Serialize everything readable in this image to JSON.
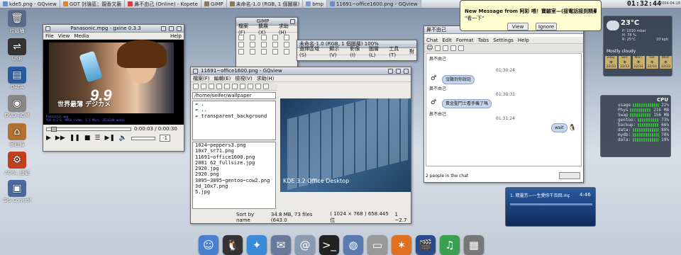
{
  "taskbar": {
    "items": [
      {
        "label": "kde5.png - GQview",
        "active": false,
        "color": "#6b8cc3"
      },
      {
        "label": "GOT 討論區：靚香文藝",
        "active": false,
        "color": "#d08a34"
      },
      {
        "label": "鼻不由己 (Online) - Kopete",
        "active": false,
        "color": "#c44"
      },
      {
        "label": "GIMP",
        "active": false,
        "color": "#8a7a5a"
      },
      {
        "label": "未命名-1.0 (RGB, 1 個圖層)",
        "active": false,
        "color": "#8a7a5a"
      },
      {
        "label": "bmp",
        "active": false,
        "color": "#7a9ad0"
      },
      {
        "label": "11691~office1600.png - GQview",
        "active": true,
        "color": "#6b8cc3"
      }
    ],
    "clock": "01:32:44",
    "date": "2004-04-18"
  },
  "desktop_icons": [
    {
      "name": "trash-icon",
      "label": "垃圾桶",
      "glyph": "🗑",
      "color": "#5a6a8a"
    },
    {
      "name": "usb-icon",
      "label": "USB",
      "glyph": "⇌",
      "color": "#333"
    },
    {
      "name": "data-icon",
      "label": "DATA",
      "glyph": "▤",
      "color": "#2a5aa0"
    },
    {
      "name": "dvd-icon",
      "label": "DVD-ROM",
      "glyph": "◉",
      "color": "#888"
    },
    {
      "name": "home-icon",
      "label": "家目錄",
      "glyph": "⌂",
      "color": "#b07030"
    },
    {
      "name": "adsl-icon",
      "label": "ADSL 撥號",
      "glyph": "⚙",
      "color": "#c04020"
    },
    {
      "name": "sis-icon",
      "label": "SiS Control",
      "glyph": "▣",
      "color": "#4a6aa0"
    }
  ],
  "xine": {
    "title": "Panasonic.mpg - gxine 0.3.3",
    "menu": [
      "File",
      "View",
      "Media",
      "Help"
    ],
    "overlay_big": "9.9",
    "overlay_text": "世界最薄 デジカメ",
    "stream_info_line1": "Panasonic.mpg",
    "stream_info_line2": "YUV 4:2:0, MPEG video, 1.5 Mb/s, 352x240 audio",
    "time": "0:00:03 / 0:00:30",
    "volume_box": "-1"
  },
  "gimp_toolbox": {
    "title": "GIMP",
    "menu": [
      "檔案(F)",
      "擴展(X)",
      "求助(H)"
    ]
  },
  "gimp_image": {
    "title": "未命名-1.0 (RGB, 1 個圖層) 100%",
    "menu": [
      "選擇區域(S)",
      "顯示(V)",
      "影像(I)",
      "圖層(L)",
      "工具(T)",
      "對"
    ]
  },
  "gqview": {
    "title": "11691~office1600.png - GQview",
    "menu": [
      "檔案(F)",
      "編輯(E)",
      "檢視(V)",
      "求助(H)"
    ],
    "path": "/home/seifer/wallpaper",
    "dirs": [
      ".",
      "..",
      "transparent_background"
    ],
    "files": [
      "1024~peppers3.png",
      "10x7_sr71.png",
      "11691~office1600.png",
      "2001 62_fullsize.jpg",
      "2920.jpg",
      "2920.png",
      "3895~3895~gentoo~cow2.png",
      "3d_10x7.png",
      "5.jpg"
    ],
    "status": [
      "Sort by name",
      "34.8 MB, 73 files (643.0",
      "( 1024 × 768 ) 658.445 位",
      "1 ~2.7"
    ],
    "image_text": "KDE 3.2 Office Desktop"
  },
  "notify": {
    "title": "New Message from 阿彩 喂！寶驗室—(接電話接到精藥病>",
    "body": "\"看一下\"",
    "buttons": [
      "View",
      "Ignore"
    ]
  },
  "chat": {
    "menu": [
      "Chat",
      "Edit",
      "Format",
      "Tabs",
      "Settings",
      "Help"
    ],
    "messages": [
      {
        "time": "01:30:24",
        "text": "沒聽到你說話",
        "nick": "鼻不由己"
      },
      {
        "time": "01:30:31",
        "text": "黃金聖鬥士看手機了嗎",
        "nick": "鼻不由己"
      },
      {
        "time": "01:31:24",
        "text": "wait",
        "nick": ""
      }
    ],
    "first_nick": "鼻不由己",
    "status": "2 people in the chat"
  },
  "weather": {
    "temp": "23°C",
    "details": "P: 1010 mbar\nH: 78 %\nR: 25°C",
    "wind": "10 kph",
    "summary": "Mostly cloudy",
    "days": [
      "2day:",
      "Sun:",
      "Mon:",
      "Tue:",
      "Wed:"
    ],
    "temps": [
      "22/33",
      "22/33",
      "22/33",
      "22/33",
      "22/33"
    ]
  },
  "sysmon": {
    "title": "CPU",
    "rows": [
      {
        "label": "usage",
        "value": "22%"
      },
      {
        "label": "Phys",
        "value": "216 MB"
      },
      {
        "label": "Swap",
        "value": "156 MB"
      },
      {
        "label": "gentoo:",
        "value": "73%"
      },
      {
        "label": "backup:",
        "value": "66%"
      },
      {
        "label": "data:",
        "value": "88%"
      },
      {
        "label": "mydb:",
        "value": "70%"
      },
      {
        "label": "daTa:",
        "value": "19%"
      }
    ]
  },
  "music": {
    "track": "1. 精靈芳—一生愛你千百回.mp3",
    "time": "4:46"
  },
  "dock": [
    {
      "name": "finder-icon",
      "glyph": "☺",
      "color": "#4a7fd0"
    },
    {
      "name": "penguin-icon",
      "glyph": "🐧",
      "color": "#333"
    },
    {
      "name": "safari-icon",
      "glyph": "✦",
      "color": "#3a8ad8"
    },
    {
      "name": "mail-icon",
      "glyph": "✉",
      "color": "#6a7a9a"
    },
    {
      "name": "at-icon",
      "glyph": "@",
      "color": "#8a9ab0"
    },
    {
      "name": "terminal-icon",
      "glyph": ">_",
      "color": "#222"
    },
    {
      "name": "network-icon",
      "glyph": "◍",
      "color": "#5a7ab0"
    },
    {
      "name": "harddisk-icon",
      "glyph": "▭",
      "color": "#999"
    },
    {
      "name": "messenger-icon",
      "glyph": "✶",
      "color": "#e07020"
    },
    {
      "name": "clapper-icon",
      "glyph": "🎬",
      "color": "#2a4a8a"
    },
    {
      "name": "music-icon",
      "glyph": "♫",
      "color": "#3aa050"
    },
    {
      "name": "photo-icon",
      "glyph": "▦",
      "color": "#777"
    }
  ]
}
